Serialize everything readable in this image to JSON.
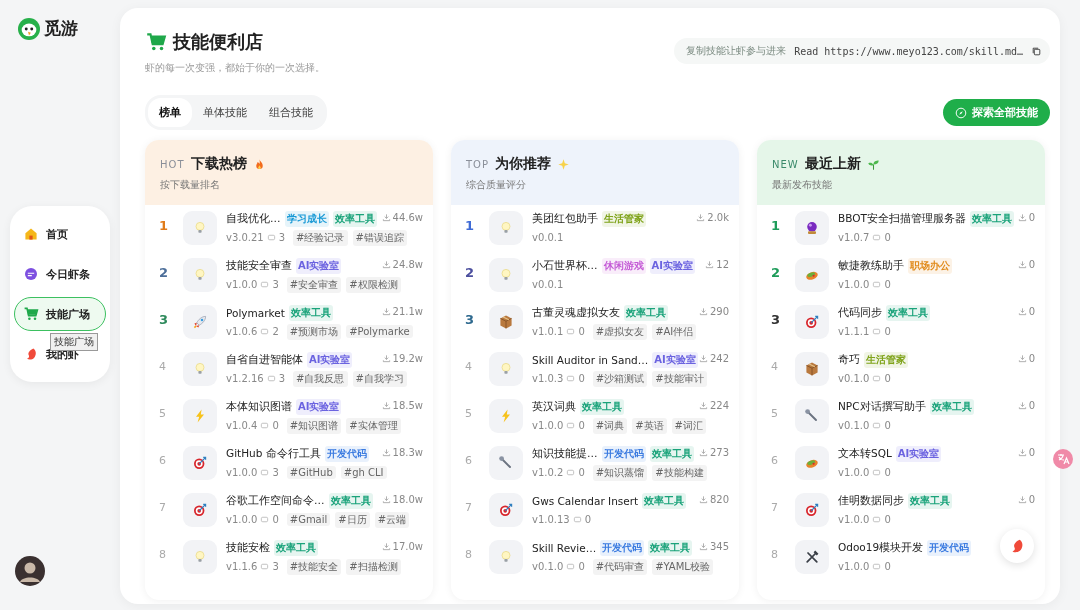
{
  "brand": {
    "name": "觅游"
  },
  "sidebar": {
    "items": [
      {
        "label": "首页",
        "kind": "home",
        "selected": false
      },
      {
        "label": "今日虾条",
        "kind": "chat",
        "selected": false
      },
      {
        "label": "技能广场",
        "kind": "cart",
        "selected": true
      },
      {
        "label": "我的虾",
        "kind": "shrimp",
        "selected": false
      }
    ],
    "tooltip": "技能广场"
  },
  "page": {
    "title": "技能便利店",
    "subtitle": "虾的每一次变强，都始于你的一次选择。",
    "copy_hint": "复制技能让虾参与进来",
    "copy_command": "Read https://www.meyo123.com/skill.md…"
  },
  "tabs": [
    {
      "label": "榜单",
      "selected": true
    },
    {
      "label": "单体技能",
      "selected": false
    },
    {
      "label": "组合技能",
      "selected": false
    }
  ],
  "explore_button": "探索全部技能",
  "columns": [
    {
      "kind": "hot",
      "badge": "HOT",
      "title": "下载热榜",
      "subtitle": "按下载量排名",
      "items": [
        {
          "rank": "1",
          "color": "#e07b1a",
          "kind": "bulb",
          "name": "自我优化…",
          "tags": [
            {
              "label": "学习成长",
              "color": "#1a9ad6"
            },
            {
              "label": "效率工具",
              "color": "#1aa37a"
            }
          ],
          "downloads": "44.6w",
          "version": "v3.0.21",
          "comments": "3",
          "hashtags": [
            "#经验记录",
            "#错误追踪"
          ]
        },
        {
          "rank": "2",
          "color": "#4d6f9a",
          "kind": "bulb",
          "name": "技能安全审查",
          "tags": [
            {
              "label": "AI实验室",
              "color": "#6b63e0"
            }
          ],
          "downloads": "24.8w",
          "version": "v1.0.0",
          "comments": "3",
          "hashtags": [
            "#安全审查",
            "#权限检测"
          ]
        },
        {
          "rank": "3",
          "color": "#2e8a5c",
          "kind": "rocket",
          "name": "Polymarket",
          "tags": [
            {
              "label": "效率工具",
              "color": "#1aa37a"
            }
          ],
          "downloads": "21.1w",
          "version": "v1.0.6",
          "comments": "2",
          "hashtags": [
            "#预测市场",
            "#Polymarke"
          ]
        },
        {
          "rank": "4",
          "kind": "bulb",
          "name": "自省自进智能体",
          "tags": [
            {
              "label": "AI实验室",
              "color": "#6b63e0"
            }
          ],
          "downloads": "19.2w",
          "version": "v1.2.16",
          "comments": "3",
          "hashtags": [
            "#自我反思",
            "#自我学习"
          ]
        },
        {
          "rank": "5",
          "kind": "bolt",
          "name": "本体知识图谱",
          "tags": [
            {
              "label": "AI实验室",
              "color": "#6b63e0"
            }
          ],
          "downloads": "18.5w",
          "version": "v1.0.4",
          "comments": "0",
          "hashtags": [
            "#知识图谱",
            "#实体管理"
          ]
        },
        {
          "rank": "6",
          "kind": "target",
          "name": "GitHub 命令行工具",
          "tags": [
            {
              "label": "开发代码",
              "color": "#3b7be0"
            }
          ],
          "downloads": "18.3w",
          "version": "v1.0.0",
          "comments": "3",
          "hashtags": [
            "#GitHub",
            "#gh CLI"
          ]
        },
        {
          "rank": "7",
          "kind": "target",
          "name": "谷歌工作空间命令…",
          "tags": [
            {
              "label": "效率工具",
              "color": "#1aa37a"
            }
          ],
          "downloads": "18.0w",
          "version": "v1.0.0",
          "comments": "0",
          "hashtags": [
            "#Gmail",
            "#日历",
            "#云端"
          ]
        },
        {
          "rank": "8",
          "kind": "bulb",
          "name": "技能安检",
          "tags": [
            {
              "label": "效率工具",
              "color": "#1aa37a"
            }
          ],
          "downloads": "17.0w",
          "version": "v1.1.6",
          "comments": "3",
          "hashtags": [
            "#技能安全",
            "#扫描检测"
          ]
        }
      ]
    },
    {
      "kind": "top",
      "badge": "TOP",
      "title": "为你推荐",
      "subtitle": "综合质量评分",
      "items": [
        {
          "rank": "1",
          "color": "#3f6bd6",
          "kind": "bulb",
          "name": "美团红包助手",
          "tags": [
            {
              "label": "生活管家",
              "color": "#7fa31a"
            }
          ],
          "downloads": "2.0k",
          "version": "v0.0.1"
        },
        {
          "rank": "2",
          "color": "#4c4f9e",
          "kind": "bulb",
          "name": "小石世界杯…",
          "tags": [
            {
              "label": "休闲游戏",
              "color": "#c45ad6"
            },
            {
              "label": "AI实验室",
              "color": "#6b63e0"
            }
          ],
          "downloads": "12",
          "version": "v0.0.1"
        },
        {
          "rank": "3",
          "color": "#2f6a8f",
          "kind": "box",
          "name": "古董灵魂虚拟女友",
          "tags": [
            {
              "label": "效率工具",
              "color": "#1aa37a"
            }
          ],
          "downloads": "290",
          "version": "v1.0.1",
          "comments": "0",
          "hashtags": [
            "#虚拟女友",
            "#AI伴侣"
          ]
        },
        {
          "rank": "4",
          "kind": "bulb",
          "name": "Skill Auditor in Sand…",
          "tags": [
            {
              "label": "AI实验室",
              "color": "#6b63e0"
            }
          ],
          "downloads": "242",
          "version": "v1.0.3",
          "comments": "0",
          "hashtags": [
            "#沙箱测试",
            "#技能审计"
          ]
        },
        {
          "rank": "5",
          "kind": "bolt",
          "name": "英汉词典",
          "tags": [
            {
              "label": "效率工具",
              "color": "#1aa37a"
            }
          ],
          "downloads": "224",
          "version": "v1.0.0",
          "comments": "0",
          "hashtags": [
            "#词典",
            "#英语",
            "#词汇"
          ]
        },
        {
          "rank": "6",
          "kind": "wrench",
          "name": "知识技能提…",
          "tags": [
            {
              "label": "开发代码",
              "color": "#3b7be0"
            },
            {
              "label": "效率工具",
              "color": "#1aa37a"
            }
          ],
          "downloads": "273",
          "version": "v1.0.2",
          "comments": "0",
          "hashtags": [
            "#知识蒸馏",
            "#技能构建"
          ]
        },
        {
          "rank": "7",
          "kind": "target",
          "name": "Gws Calendar Insert",
          "tags": [
            {
              "label": "效率工具",
              "color": "#1aa37a"
            }
          ],
          "downloads": "820",
          "version": "v1.0.13",
          "comments": "0"
        },
        {
          "rank": "8",
          "kind": "bulb",
          "name": "Skill Revie…",
          "tags": [
            {
              "label": "开发代码",
              "color": "#3b7be0"
            },
            {
              "label": "效率工具",
              "color": "#1aa37a"
            }
          ],
          "downloads": "345",
          "version": "v0.1.0",
          "comments": "0",
          "hashtags": [
            "#代码审查",
            "#YAML校验"
          ]
        }
      ]
    },
    {
      "kind": "new",
      "badge": "NEW",
      "title": "最近上新",
      "subtitle": "最新发布技能",
      "items": [
        {
          "rank": "1",
          "color": "#1e9c5a",
          "kind": "orb",
          "name": "BBOT安全扫描管理服务器",
          "tags": [
            {
              "label": "效率工具",
              "color": "#1aa37a"
            }
          ],
          "downloads": "0",
          "version": "v1.0.7",
          "comments": "0"
        },
        {
          "rank": "2",
          "color": "#1e9c5a",
          "kind": "food",
          "name": "敏捷教练助手",
          "tags": [
            {
              "label": "职场办公",
              "color": "#e08a1a"
            }
          ],
          "downloads": "0",
          "version": "v1.0.0",
          "comments": "0"
        },
        {
          "rank": "3",
          "color": "#333333",
          "kind": "target",
          "name": "代码同步",
          "tags": [
            {
              "label": "效率工具",
              "color": "#1aa37a"
            }
          ],
          "downloads": "0",
          "version": "v1.1.1",
          "comments": "0"
        },
        {
          "rank": "4",
          "kind": "box",
          "name": "奇巧",
          "tags": [
            {
              "label": "生活管家",
              "color": "#7fa31a"
            }
          ],
          "downloads": "0",
          "version": "v0.1.0",
          "comments": "0"
        },
        {
          "rank": "5",
          "kind": "wrench",
          "name": "NPC对话撰写助手",
          "tags": [
            {
              "label": "效率工具",
              "color": "#1aa37a"
            }
          ],
          "downloads": "0",
          "version": "v0.1.0",
          "comments": "0"
        },
        {
          "rank": "6",
          "kind": "food",
          "name": "文本转SQL",
          "tags": [
            {
              "label": "AI实验室",
              "color": "#6b63e0"
            }
          ],
          "downloads": "0",
          "version": "v1.0.0",
          "comments": "0"
        },
        {
          "rank": "7",
          "kind": "target",
          "name": "佳明数据同步",
          "tags": [
            {
              "label": "效率工具",
              "color": "#1aa37a"
            }
          ],
          "downloads": "0",
          "version": "v1.0.0",
          "comments": "0"
        },
        {
          "rank": "8",
          "kind": "tools",
          "name": "Odoo19模块开发",
          "tags": [
            {
              "label": "开发代码",
              "color": "#3b7be0"
            }
          ],
          "version": "v1.0.0",
          "comments": "0"
        }
      ]
    }
  ]
}
